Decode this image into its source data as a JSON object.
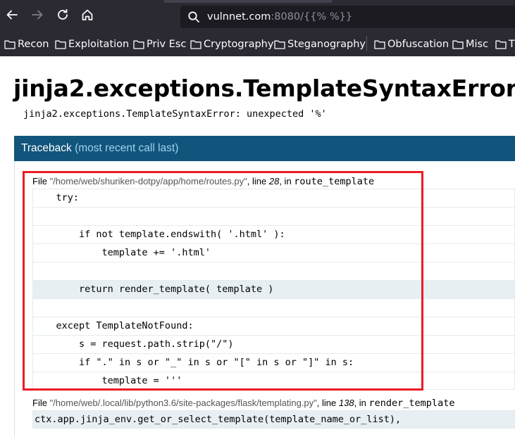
{
  "browser": {
    "url_host": "vulnnet.com",
    "url_port": ":8080/",
    "url_path": "{{% %}}",
    "bookmarks": [
      "Recon",
      "Exploitation",
      "Priv Esc",
      "Cryptography",
      "Steganography",
      "Obfuscation",
      "Misc",
      "T"
    ],
    "colors": {
      "chrome": "#2b2a33",
      "urlbar": "#1c1b22"
    }
  },
  "page": {
    "title": "jinja2.exceptions.TemplateSyntaxError",
    "message": "jinja2.exceptions.TemplateSyntaxError: unexpected '%'",
    "traceback": {
      "label": "Traceback",
      "label_note": "(most recent call last)",
      "colors": {
        "header": "#11557c",
        "highlight_box": "#ec1c24"
      },
      "frames": [
        {
          "file_prefix": "File ",
          "filename": "\"/home/web/shuriken-dotpy/app/home/routes.py\"",
          "line_label": ", line ",
          "lineno": "28",
          "in_label": ", in ",
          "function": "route_template",
          "code": [
            "    try:",
            "",
            "        if not template.endswith( '.html' ):",
            "            template += '.html'",
            "",
            "        return render_template( template )",
            "",
            "    except TemplateNotFound:",
            "        s = request.path.strip(\"/\")",
            "        if \".\" in s or \"_\" in s or \"[\" in s or \"]\" in s:",
            "            template = '''"
          ],
          "current_line_index": 5
        },
        {
          "file_prefix": "File ",
          "filename": "\"/home/web/.local/lib/python3.6/site-packages/flask/templating.py\"",
          "line_label": ", line ",
          "lineno": "138",
          "in_label": ", in ",
          "function": "render_template",
          "code": [
            "ctx.app.jinja_env.get_or_select_template(template_name_or_list),"
          ]
        }
      ]
    }
  }
}
